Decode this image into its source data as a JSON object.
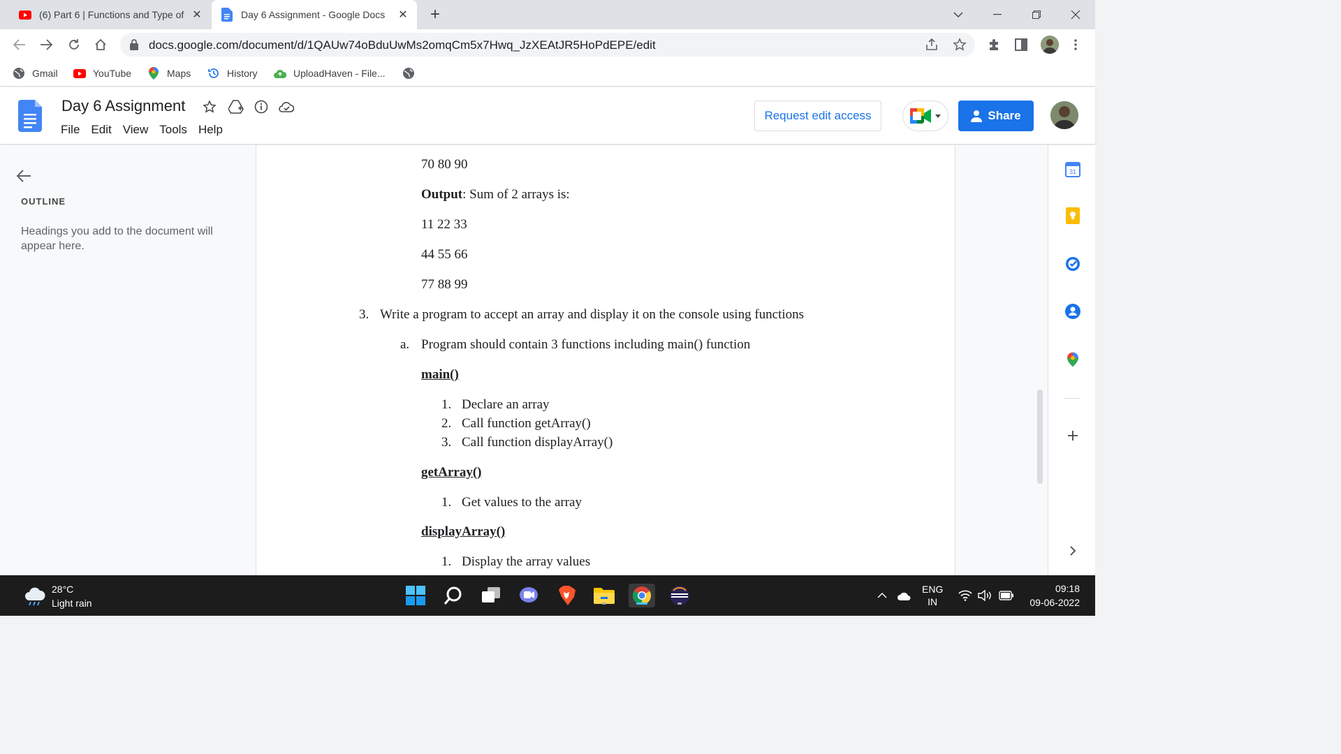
{
  "tabs": [
    {
      "title": "(6) Part 6 | Functions and Type of",
      "favicon": "youtube-icon"
    },
    {
      "title": "Day 6 Assignment - Google Docs",
      "favicon": "google-docs-icon"
    }
  ],
  "address": {
    "url": "docs.google.com/document/d/1QAUw74oBduUwMs2omqCm5x7Hwq_JzXEAtJR5HoPdEPE/edit"
  },
  "bookmarks": [
    "Gmail",
    "YouTube",
    "Maps",
    "History",
    "UploadHaven - File..."
  ],
  "docs": {
    "title": "Day 6 Assignment",
    "menu": [
      "File",
      "Edit",
      "View",
      "Tools",
      "Help"
    ],
    "request_edit_label": "Request edit access",
    "share_label": "Share"
  },
  "outline": {
    "heading": "OUTLINE",
    "placeholder": "Headings you add to the document will appear here."
  },
  "document": {
    "l1": "70 80 90",
    "output_label": "Output",
    "output_rest": ": Sum of 2 arrays is:",
    "l3": "11 22 33",
    "l4": "44 55 66",
    "l5": "77 88 99",
    "q3_num": "3.",
    "q3_text": "Write a program to accept an array and display it on the console using functions",
    "qa_num": "a.",
    "qa_text": "Program should contain 3 functions including main() function",
    "main_head": "main()",
    "main_items": [
      "Declare an array",
      "Call function getArray()",
      "Call function displayArray()"
    ],
    "get_head": "getArray()",
    "get_items": [
      "Get values to the array"
    ],
    "display_head": "displayArray()",
    "display_items": [
      "Display the array values"
    ]
  },
  "taskbar": {
    "temperature": "28°C",
    "weather": "Light rain",
    "lang_top": "ENG",
    "lang_bottom": "IN",
    "time": "09:18",
    "date": "09-06-2022"
  },
  "colors": {
    "accent": "#1a73e8",
    "docs_blue": "#4285f4",
    "taskbar": "#1c1c1c"
  }
}
